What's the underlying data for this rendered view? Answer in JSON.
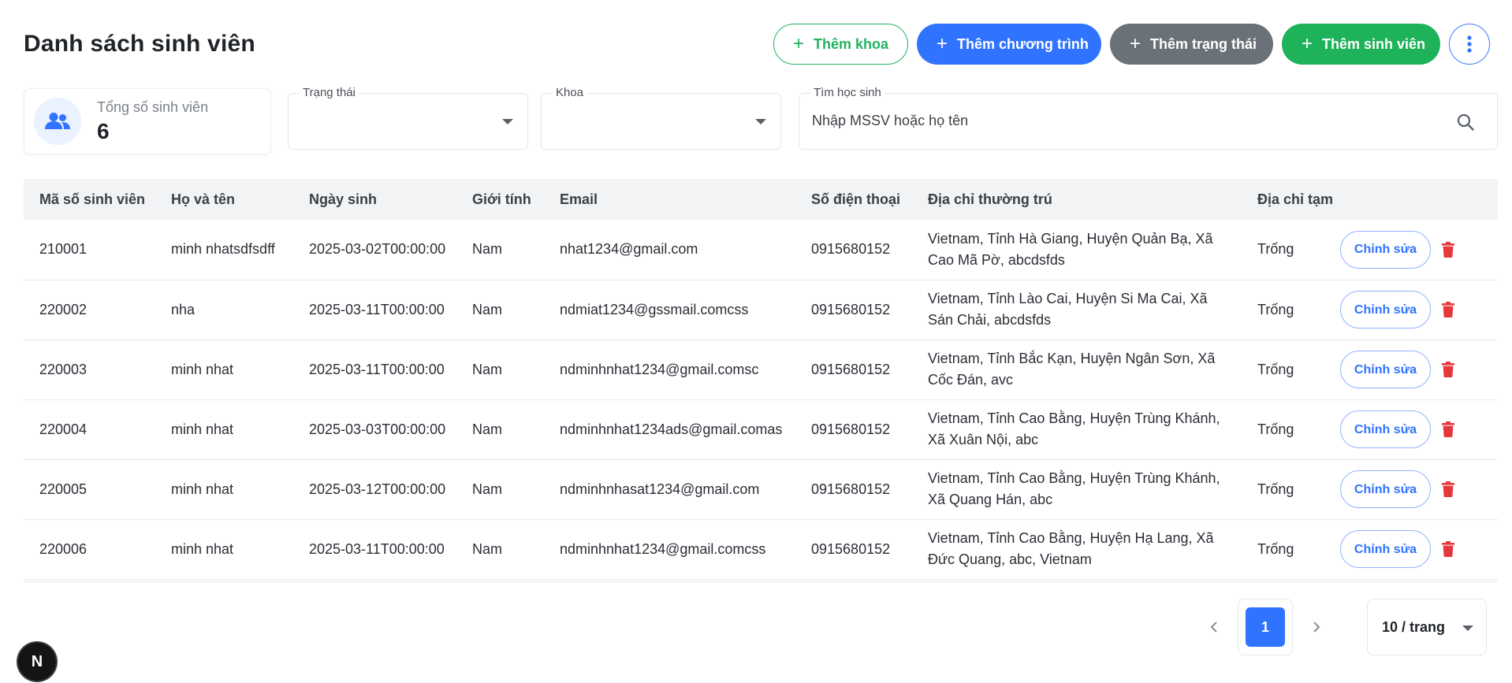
{
  "page": {
    "title": "Danh sách sinh viên"
  },
  "header": {
    "buttons": {
      "add_khoa": "Thêm khoa",
      "add_chuong_trinh": "Thêm chương trình",
      "add_trang_thai": "Thêm trạng thái",
      "add_sinh_vien": "Thêm sinh viên"
    }
  },
  "stats": {
    "label": "Tổng số sinh viên",
    "value": "6"
  },
  "filters": {
    "status_label": "Trạng thái",
    "status_value": "",
    "khoa_label": "Khoa",
    "khoa_value": "",
    "search_label": "Tìm học sinh",
    "search_placeholder": "Nhập MSSV hoặc họ tên"
  },
  "table": {
    "columns": [
      "Mã số sinh viên",
      "Họ và tên",
      "Ngày sinh",
      "Giới tính",
      "Email",
      "Số điện thoại",
      "Địa chỉ thường trú",
      "Địa chỉ tạm trú"
    ],
    "edit_label": "Chỉnh sửa",
    "rows": [
      [
        "210001",
        "minh nhatsdfsdff",
        "2025-03-02T00:00:00",
        "Nam",
        "nhat1234@gmail.com",
        "0915680152",
        "Vietnam, Tỉnh Hà Giang, Huyện Quản Bạ, Xã Cao Mã Pờ, abcdsfds",
        "Trống"
      ],
      [
        "220002",
        "nha",
        "2025-03-11T00:00:00",
        "Nam",
        "ndmiat1234@gssmail.comcss",
        "0915680152",
        "Vietnam, Tỉnh Lào Cai, Huyện Si Ma Cai, Xã Sán Chải, abcdsfds",
        "Trống"
      ],
      [
        "220003",
        "minh nhat",
        "2025-03-11T00:00:00",
        "Nam",
        "ndminhnhat1234@gmail.comsc",
        "0915680152",
        "Vietnam, Tỉnh Bắc Kạn, Huyện Ngân Sơn, Xã Cốc Đán, avc",
        "Trống"
      ],
      [
        "220004",
        "minh nhat",
        "2025-03-03T00:00:00",
        "Nam",
        "ndminhnhat1234ads@gmail.comas",
        "0915680152",
        "Vietnam, Tỉnh Cao Bằng, Huyện Trùng Khánh, Xã Xuân Nội, abc",
        "Trống"
      ],
      [
        "220005",
        "minh nhat",
        "2025-03-12T00:00:00",
        "Nam",
        "ndminhnhasat1234@gmail.com",
        "0915680152",
        "Vietnam, Tỉnh Cao Bằng, Huyện Trùng Khánh, Xã Quang Hán, abc",
        "Trống"
      ],
      [
        "220006",
        "minh nhat",
        "2025-03-11T00:00:00",
        "Nam",
        "ndminhnhat1234@gmail.comcss",
        "0915680152",
        "Vietnam, Tỉnh Cao Bằng, Huyện Hạ Lang, Xã Đức Quang, abc, Vietnam",
        "Trống"
      ]
    ]
  },
  "pagination": {
    "current_page": "1",
    "page_size": "10 / trang"
  },
  "badge": {
    "letter": "N"
  },
  "colors": {
    "primary": "#2f73ff",
    "success": "#1eb25a",
    "neutral": "#6b7178",
    "danger": "#e5383b"
  }
}
